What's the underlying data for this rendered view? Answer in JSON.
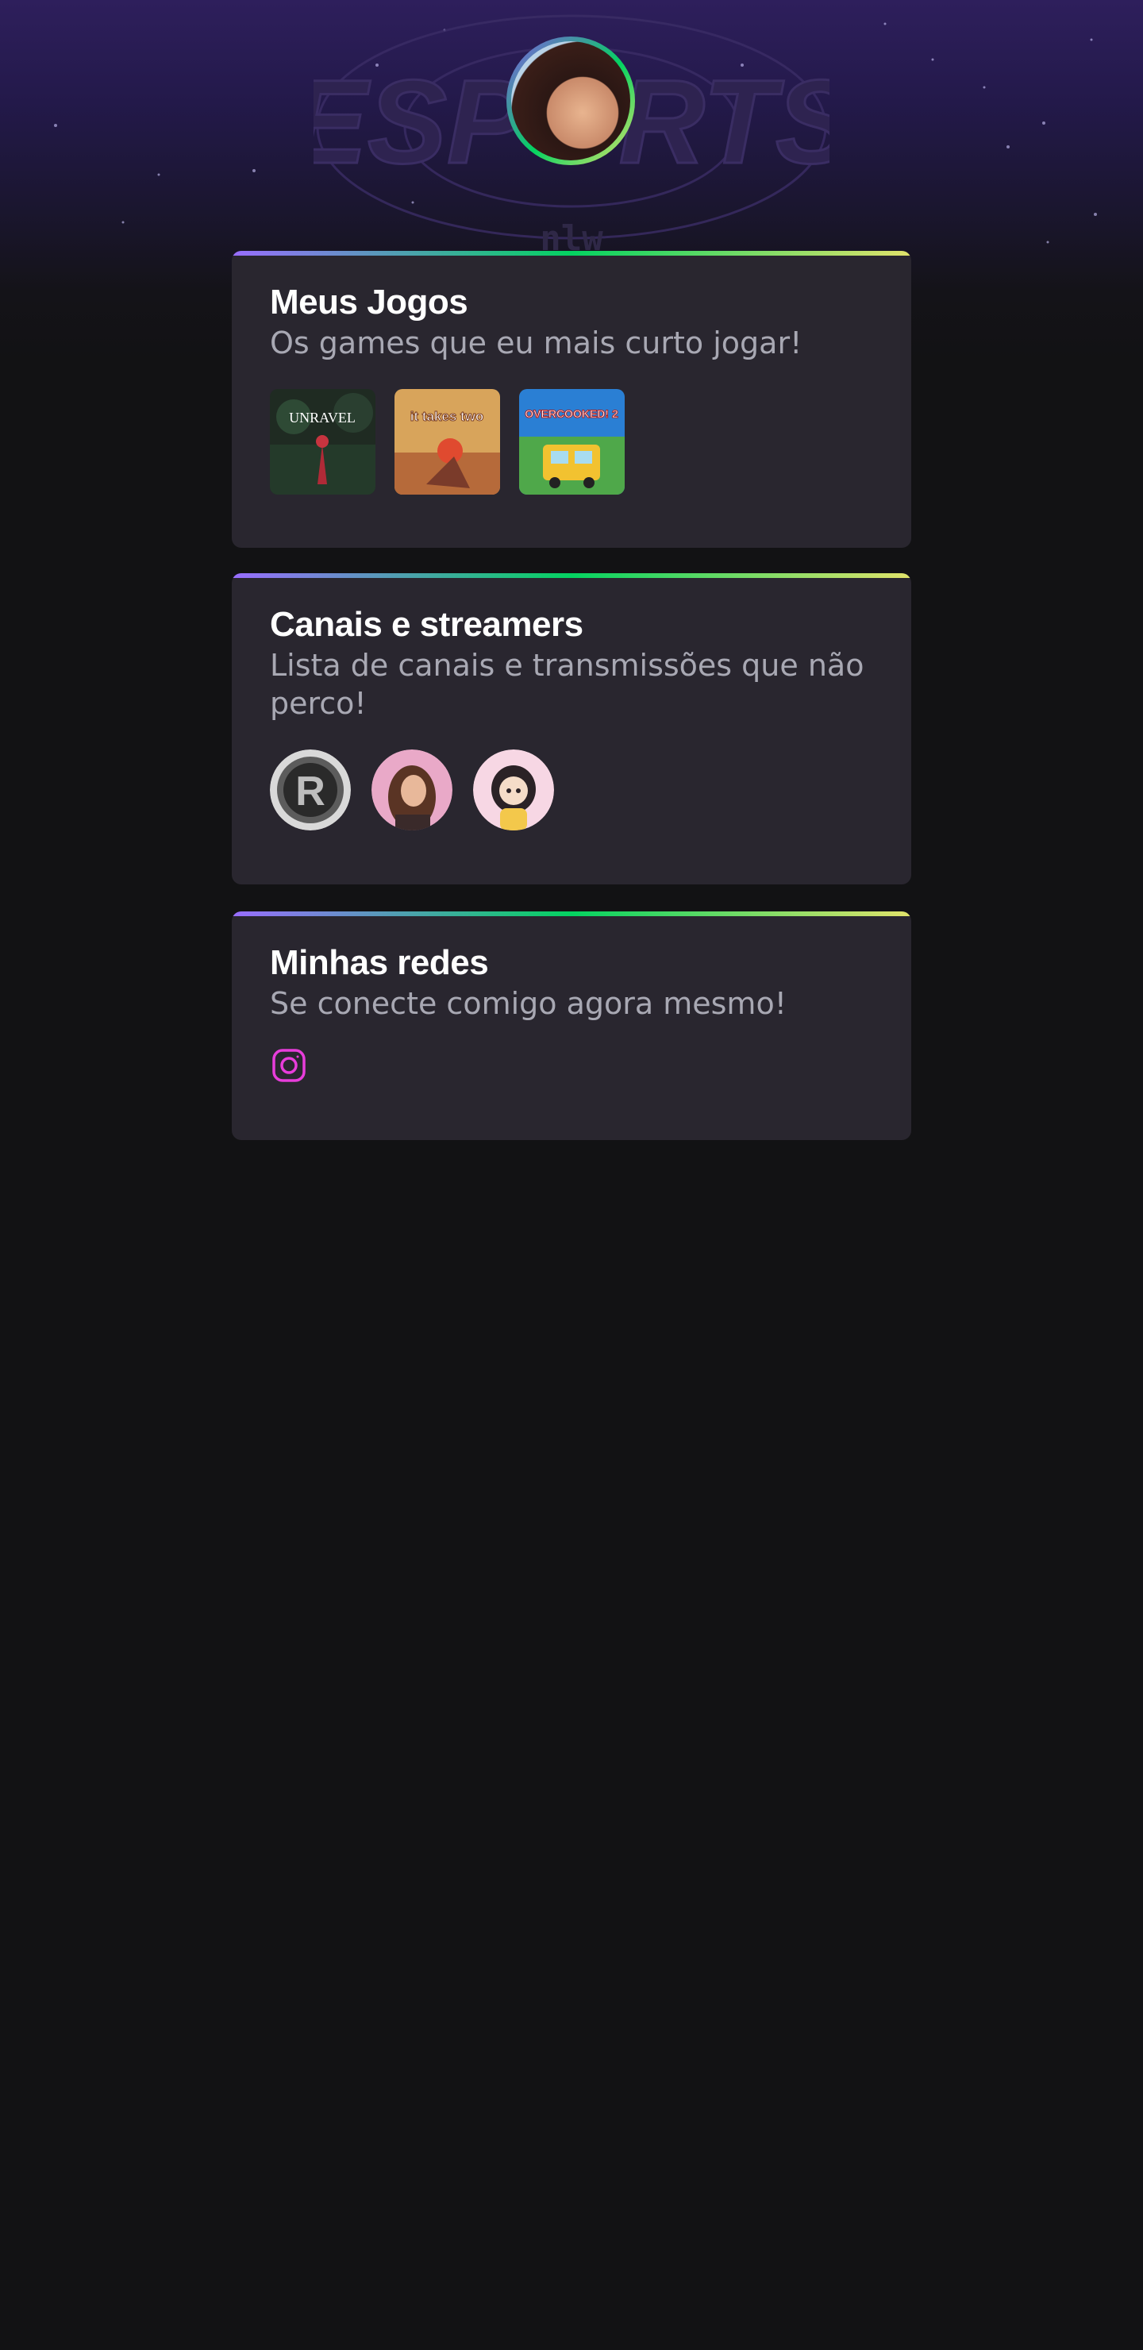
{
  "profile": {
    "avatar_alt": "",
    "colors": {
      "gradient_start": "#8257e6",
      "gradient_mid": "#04d361",
      "gradient_end": "#e1e36b"
    }
  },
  "hero": {
    "logo_text": "ESPORTS",
    "sub_logo_text": "nlw"
  },
  "games_section": {
    "title": "Meus Jogos",
    "subtitle": "Os games que eu mais curto jogar!",
    "games": [
      {
        "name": "Unravel",
        "cover_text": "UNRAVEL"
      },
      {
        "name": "It Takes Two",
        "cover_text": "it takes two"
      },
      {
        "name": "Overcooked! 2",
        "cover_text": "OVERCOOKED! 2"
      }
    ]
  },
  "channels_section": {
    "title": "Canais e streamers",
    "subtitle": "Lista de canais e transmissões que não perco!",
    "channels": [
      {
        "icon": "channel-r-logo"
      },
      {
        "icon": "streamer-photo"
      },
      {
        "icon": "streamer-illustration"
      }
    ]
  },
  "social_section": {
    "title": "Minhas redes",
    "subtitle": "Se conecte comigo agora mesmo!",
    "links": [
      {
        "icon": "instagram-icon",
        "color": "#e83ddb"
      }
    ]
  },
  "colors": {
    "background": "#121214",
    "card": "#29262f",
    "subtitle_text": "#a8a8b3",
    "accent_bar": [
      "#996dff",
      "#04d361",
      "#e1e36b"
    ]
  }
}
